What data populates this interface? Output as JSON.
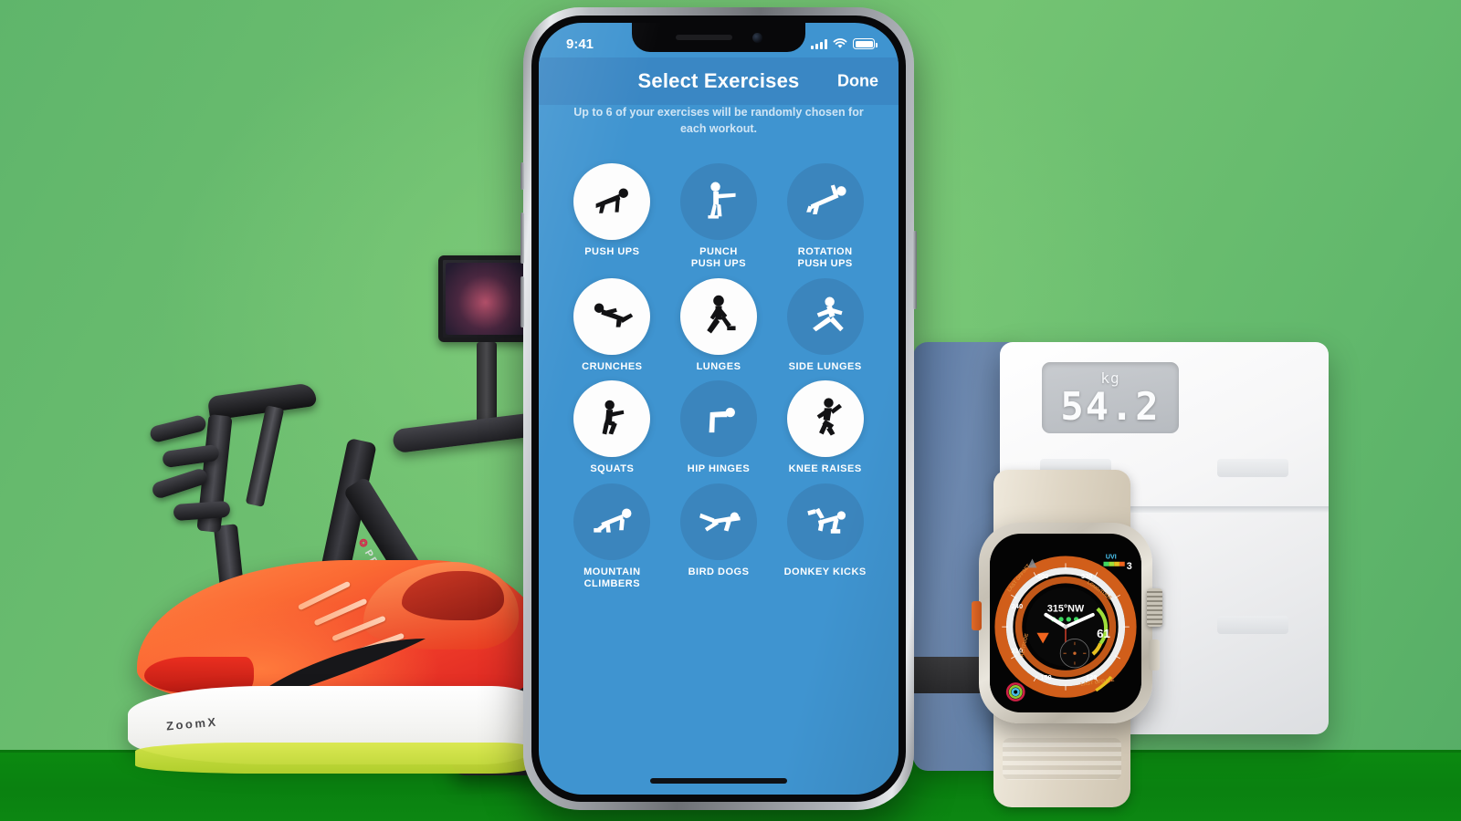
{
  "background": {
    "top_color": "#6cbe6f",
    "strip_color": "#0b8a10"
  },
  "phone": {
    "status_bar": {
      "time": "9:41",
      "signal_icon": "cellular-bars-icon",
      "wifi_icon": "wifi-icon",
      "battery_icon": "battery-full-icon"
    },
    "navbar": {
      "title": "Select Exercises",
      "done_label": "Done"
    },
    "subtitle": "Up to 6 of your exercises will be randomly chosen for each workout.",
    "accent_color": "#3f94d0",
    "navbar_color": "#3a87c4",
    "selected_color": "#fdfdfd",
    "unselected_color": "#3b85bd",
    "exercises": [
      {
        "label": "PUSH UPS",
        "icon": "push-ups-icon",
        "selected": true
      },
      {
        "label": "PUNCH\nPUSH UPS",
        "icon": "punch-push-ups-icon",
        "selected": false
      },
      {
        "label": "ROTATION\nPUSH UPS",
        "icon": "rotation-push-ups-icon",
        "selected": false
      },
      {
        "label": "CRUNCHES",
        "icon": "crunches-icon",
        "selected": true
      },
      {
        "label": "LUNGES",
        "icon": "lunges-icon",
        "selected": true
      },
      {
        "label": "SIDE LUNGES",
        "icon": "side-lunges-icon",
        "selected": false
      },
      {
        "label": "SQUATS",
        "icon": "squats-icon",
        "selected": true
      },
      {
        "label": "HIP HINGES",
        "icon": "hip-hinges-icon",
        "selected": false
      },
      {
        "label": "KNEE RAISES",
        "icon": "knee-raises-icon",
        "selected": true
      },
      {
        "label": "MOUNTAIN\nCLIMBERS",
        "icon": "mountain-climbers-icon",
        "selected": false
      },
      {
        "label": "BIRD DOGS",
        "icon": "bird-dogs-icon",
        "selected": false
      },
      {
        "label": "DONKEY KICKS",
        "icon": "donkey-kicks-icon",
        "selected": false
      }
    ]
  },
  "scale": {
    "unit": "kg",
    "weight": "54.2"
  },
  "watch": {
    "heading": "315°NW",
    "metric_value": "61",
    "uv_label": "UVI",
    "uv_value": "3",
    "bezel_ticks": [
      "330",
      "300",
      "240",
      "210",
      "150",
      "120"
    ],
    "ring_labels": [
      "LAST OFFSET",
      "ALTITUDE",
      "LONGITUDE",
      "LATITUDE",
      "LAST UPDATE"
    ]
  },
  "bike": {
    "brand": "PELOTON"
  },
  "shoe": {
    "foam_label": "ZoomX"
  }
}
